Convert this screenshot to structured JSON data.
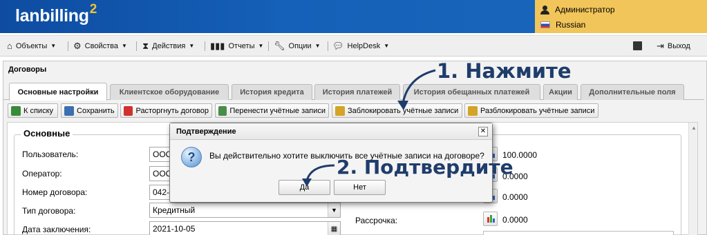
{
  "header": {
    "logo_text": "lanbilling",
    "logo_superscript": "2",
    "user": "Администратор",
    "language": "Russian"
  },
  "menu": {
    "items": [
      {
        "label": "Объекты",
        "icon": "home-icon"
      },
      {
        "label": "Свойства",
        "icon": "gear-icon"
      },
      {
        "label": "Действия",
        "icon": "hourglass-icon"
      },
      {
        "label": "Отчеты",
        "icon": "bar-chart-icon"
      },
      {
        "label": "Опции",
        "icon": "wrench-icon"
      },
      {
        "label": "HelpDesk",
        "icon": "speech-bubble-icon"
      }
    ],
    "logout": "Выход"
  },
  "panel": {
    "title": "Договоры"
  },
  "tabs": [
    "Основные настройки",
    "Клиентское оборудование",
    "История кредита",
    "История платежей",
    "История обещанных платежей",
    "Акции",
    "Дополнительные поля"
  ],
  "toolbar": [
    "К списку",
    "Сохранить",
    "Расторгнуть договор",
    "Перенести учётные записи",
    "Заблокировать учётные записи",
    "Разблокировать учётные записи"
  ],
  "form": {
    "section": "Основные",
    "fields": [
      {
        "label": "Пользователь:",
        "value": "ООО"
      },
      {
        "label": "Оператор:",
        "value": "ООО"
      },
      {
        "label": "Номер договора:",
        "value": "042-"
      },
      {
        "label": "Тип договора:",
        "value": "Кредитный"
      },
      {
        "label": "Дата заключения:",
        "value": "2021-10-05"
      }
    ],
    "right_values": [
      "100.0000",
      "0.0000",
      "0.0000"
    ],
    "installment": {
      "label": "Рассрочка:",
      "value": "0.0000"
    }
  },
  "dialog": {
    "title": "Подтверждение",
    "message": "Вы действительно хотите выключить все учётные записи на договоре?",
    "yes": "Да",
    "no": "Нет"
  },
  "annotations": {
    "step1": "1. Нажмите",
    "step2": "2. Подтвердите"
  },
  "colors": {
    "header_blue": "#1560b8",
    "user_panel": "#f1c55a",
    "annotation": "#1f3d6b"
  }
}
